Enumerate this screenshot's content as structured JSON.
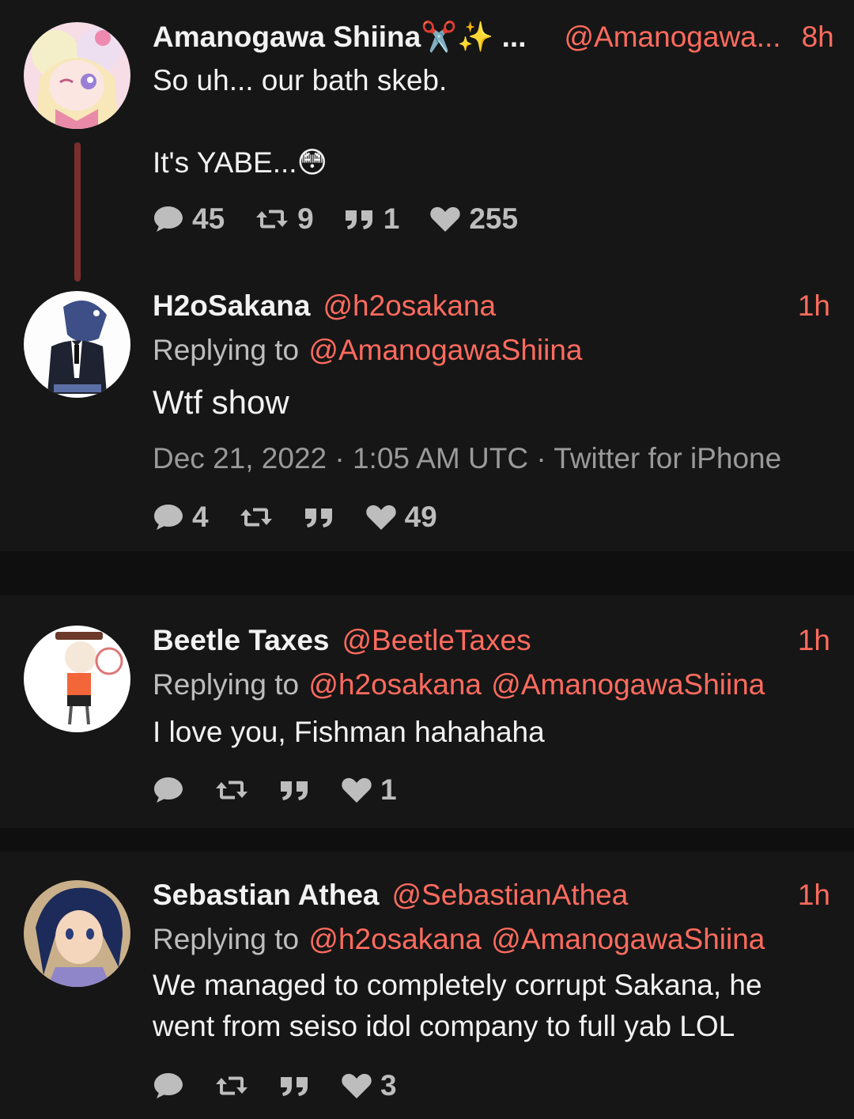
{
  "tweets": [
    {
      "name": "Amanogawa Shiina",
      "name_suffix": "✂️✨ ...",
      "handle": "@Amanogawa...",
      "time": "8h",
      "text_line1": "So uh... our bath skeb.",
      "text_line2": "It's YABE...😳",
      "stats": {
        "replies": "45",
        "retweets": "9",
        "quotes": "1",
        "likes": "255"
      }
    },
    {
      "name": "H2oSakana",
      "handle": "@h2osakana",
      "time": "1h",
      "reply_label": "Replying to",
      "reply_to": [
        "@AmanogawaShiina"
      ],
      "text": "Wtf show",
      "meta": "Dec 21, 2022 · 1:05 AM UTC · Twitter for iPhone",
      "stats": {
        "replies": "4",
        "retweets": "",
        "quotes": "",
        "likes": "49"
      }
    },
    {
      "name": "Beetle Taxes",
      "handle": "@BeetleTaxes",
      "time": "1h",
      "reply_label": "Replying to",
      "reply_to": [
        "@h2osakana",
        "@AmanogawaShiina"
      ],
      "text": "I love you, Fishman hahahaha",
      "stats": {
        "replies": "",
        "retweets": "",
        "quotes": "",
        "likes": "1"
      }
    },
    {
      "name": "Sebastian Athea",
      "handle": "@SebastianAthea",
      "time": "1h",
      "reply_label": "Replying to",
      "reply_to": [
        "@h2osakana",
        "@AmanogawaShiina"
      ],
      "text_line1": "We managed to completely corrupt Sakana, he",
      "text_line2": "went from seiso idol company to full yab LOL",
      "stats": {
        "replies": "",
        "retweets": "",
        "quotes": "",
        "likes": "3"
      }
    }
  ],
  "colors": {
    "background": "#0f0f0f",
    "card": "#161616",
    "accent": "#ff6b5e",
    "thread_line": "#7a2e2e"
  }
}
